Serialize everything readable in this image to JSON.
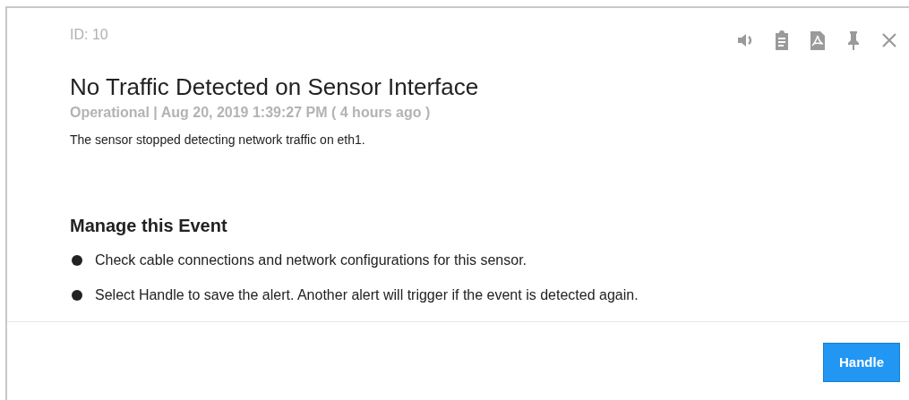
{
  "id_label": "ID: 10",
  "toolbar": [
    {
      "kind": "sound"
    },
    {
      "kind": "clipboard"
    },
    {
      "kind": "pdf"
    },
    {
      "kind": "pin"
    },
    {
      "kind": "close"
    }
  ],
  "title": "No Traffic Detected on Sensor Interface",
  "meta": "Operational | Aug 20, 2019 1:39:27 PM ( 4 hours ago )",
  "description": "The sensor stopped detecting network traffic on eth1.",
  "manage": {
    "heading": "Manage this Event",
    "steps": [
      "Check cable connections and network configurations for this sensor.",
      "Select Handle to save the alert. Another alert will trigger if the event is detected again."
    ]
  },
  "buttons": [
    {
      "label": "Handle"
    }
  ]
}
